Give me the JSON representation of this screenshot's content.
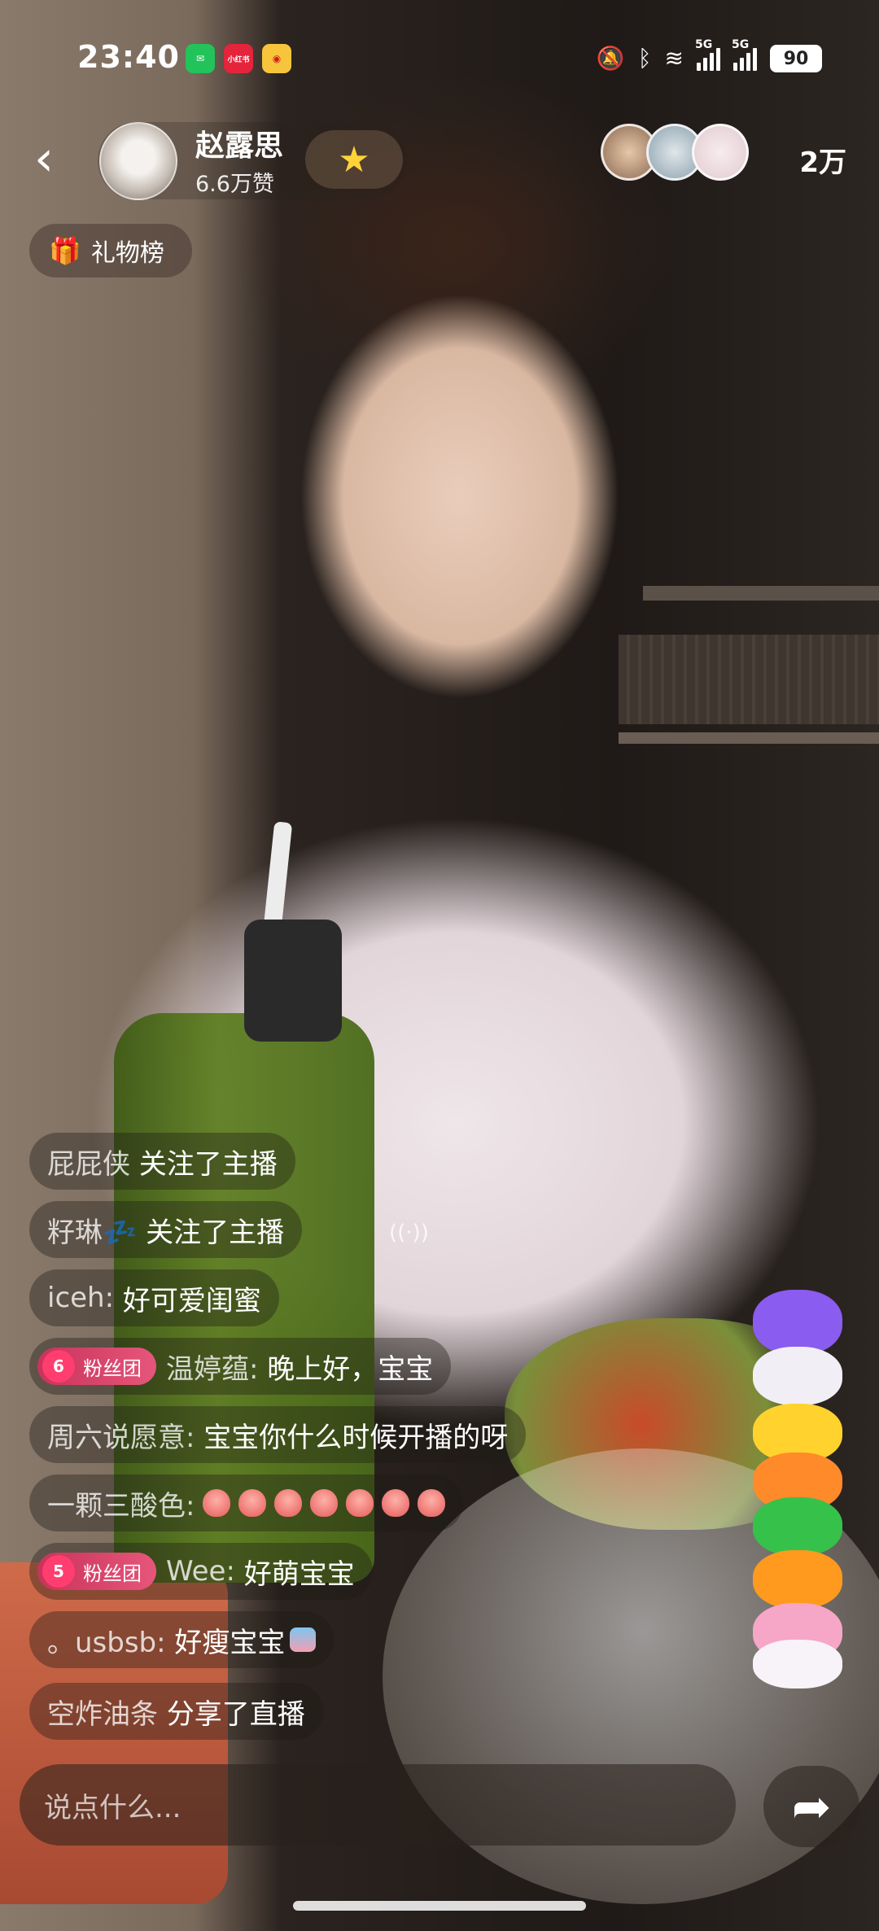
{
  "status_bar": {
    "time": "23:40",
    "apps": [
      "wechat-icon",
      "xiaohongshu-icon",
      "weibo-icon"
    ],
    "xhs_label": "小红书",
    "network_labels": [
      "5G",
      "5G"
    ],
    "battery": "90"
  },
  "header": {
    "host_name": "赵露思",
    "likes": "6.6万赞",
    "viewer_count": "2万",
    "gift_list_label": "礼物榜"
  },
  "chat": [
    {
      "nick": "屁屁侠",
      "text": "关注了主播"
    },
    {
      "nick": "籽琳💤",
      "text": "关注了主播"
    },
    {
      "nick": "iceh:",
      "text": "好可爱闺蜜"
    },
    {
      "badge_level": "6",
      "badge_label": "粉丝团",
      "nick": "温婷蕴:",
      "text": "晚上好，宝宝"
    },
    {
      "nick": "周六说愿意:",
      "text": "宝宝你什么时候开播的呀"
    },
    {
      "nick": "一颗三酸色:",
      "text": ""
    },
    {
      "badge_level": "5",
      "badge_label": "粉丝团",
      "nick": "Wee:",
      "text": "好萌宝宝"
    },
    {
      "nick": "。usbsb:",
      "text": "好瘦宝宝"
    },
    {
      "nick": "空炸油条",
      "text": "分享了直播"
    }
  ],
  "input": {
    "placeholder": "说点什么..."
  },
  "colors": {
    "badge": "#d8456a",
    "heart": "#ff3d6e",
    "star": "#ffd23a"
  }
}
